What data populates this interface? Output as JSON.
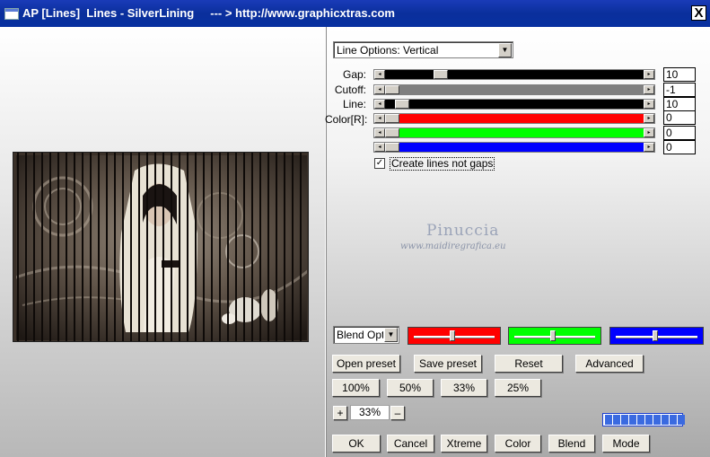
{
  "window": {
    "title": "AP [Lines]  Lines - SilverLining     --- > http://www.graphicxtras.com",
    "close_glyph": "X"
  },
  "options": {
    "line_options_value": "Line Options: Vertical"
  },
  "sliders": [
    {
      "label": "Gap:",
      "value": "10",
      "fraction": 0.2,
      "track_color": "#000000"
    },
    {
      "label": "Cutoff:",
      "value": "-1",
      "fraction": 0.0,
      "track_color": "#808080"
    },
    {
      "label": "Line:",
      "value": "10",
      "fraction": 0.04,
      "track_color": "#000000"
    },
    {
      "label": "Color[R]:",
      "value": "0",
      "fraction": 0.0,
      "track_color": "#ff0000"
    },
    {
      "label": "",
      "value": "0",
      "fraction": 0.0,
      "track_color": "#00ff00"
    },
    {
      "label": "",
      "value": "0",
      "fraction": 0.0,
      "track_color": "#0000ff"
    }
  ],
  "checkbox": {
    "label": "Create lines not gaps",
    "checked": true,
    "mark": "✓"
  },
  "watermark": {
    "title": "Pinuccia",
    "subtitle": "www.maidiregrafica.eu"
  },
  "blend": {
    "select_value": "Blend Optic",
    "pickers": [
      {
        "color": "#ff0000",
        "level": 0.48
      },
      {
        "color": "#00ff00",
        "level": 0.48
      },
      {
        "color": "#0000ff",
        "level": 0.48
      }
    ]
  },
  "preset_buttons": {
    "open": "Open preset",
    "save": "Save preset",
    "reset": "Reset",
    "advanced": "Advanced"
  },
  "zoom_buttons": [
    "100%",
    "50%",
    "33%",
    "25%"
  ],
  "zoom": {
    "plus": "+",
    "value": "33%",
    "minus": "–"
  },
  "progress": {
    "segments": 10,
    "filled": 10,
    "color": "#3a6ae0"
  },
  "bottom_buttons": {
    "ok": "OK",
    "cancel": "Cancel",
    "xtreme": "Xtreme",
    "color": "Color",
    "blend": "Blend",
    "mode": "Mode"
  },
  "colors": {
    "title_bar": "#0a2f9c",
    "accent": "#1b3fd0"
  }
}
